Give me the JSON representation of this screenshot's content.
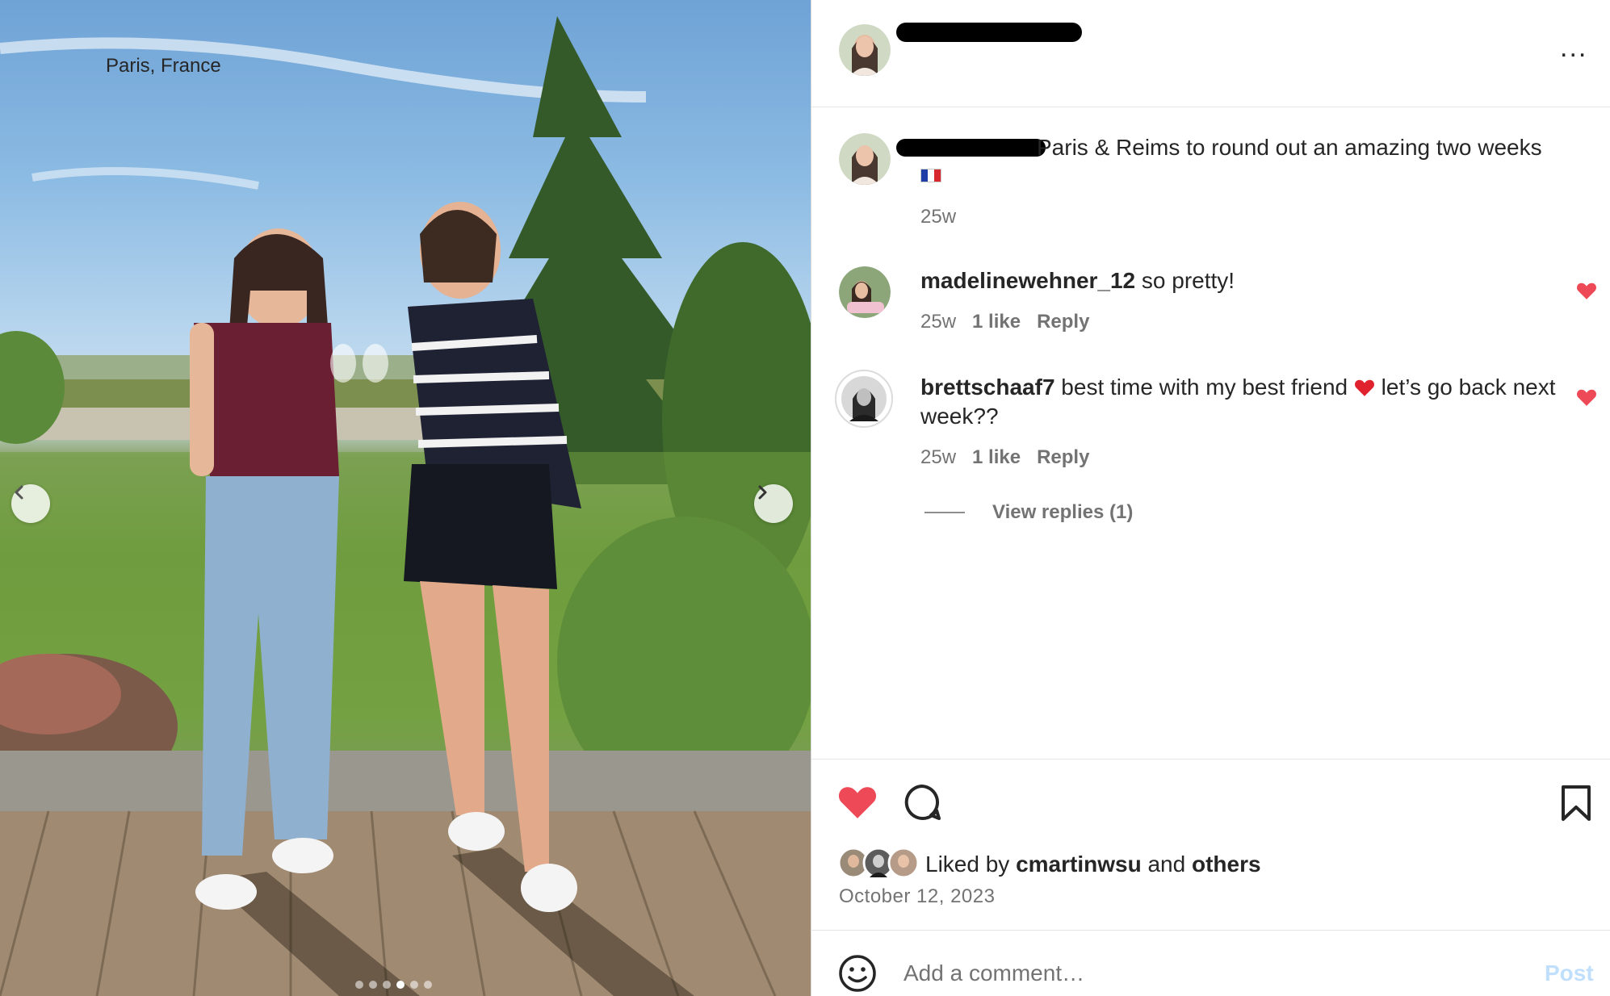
{
  "post": {
    "location": "Paris, France",
    "caption": "Paris & Reims to round out an amazing two weeks",
    "caption_age": "25w",
    "more_label": "..."
  },
  "comments": [
    {
      "username": "madelinewehner_12",
      "text": " so pretty!",
      "age": "25w",
      "likes": "1 like",
      "reply": "Reply",
      "liked": true
    },
    {
      "username": "brettschaaf7",
      "text_before": " best time with my best friend ",
      "text_after": " let’s go back next week??",
      "age": "25w",
      "likes": "1 like",
      "reply": "Reply",
      "liked": true
    }
  ],
  "view_replies": "View replies (1)",
  "likes": {
    "prefix": "Liked by ",
    "user": "cmartinwsu",
    "middle": " and ",
    "others": "others"
  },
  "date": "October 12, 2023",
  "composer": {
    "placeholder": "Add a comment…",
    "post_label": "Post"
  },
  "carousel": {
    "count": 6,
    "active_index": 3
  },
  "colors": {
    "heart": "#ed4956",
    "post_disabled": "#c0dffd",
    "muted": "#737373"
  },
  "icons": [
    "heart-icon",
    "comment-icon",
    "bookmark-icon",
    "emoji-icon",
    "chevron-left-icon",
    "chevron-right-icon",
    "more-icon"
  ]
}
